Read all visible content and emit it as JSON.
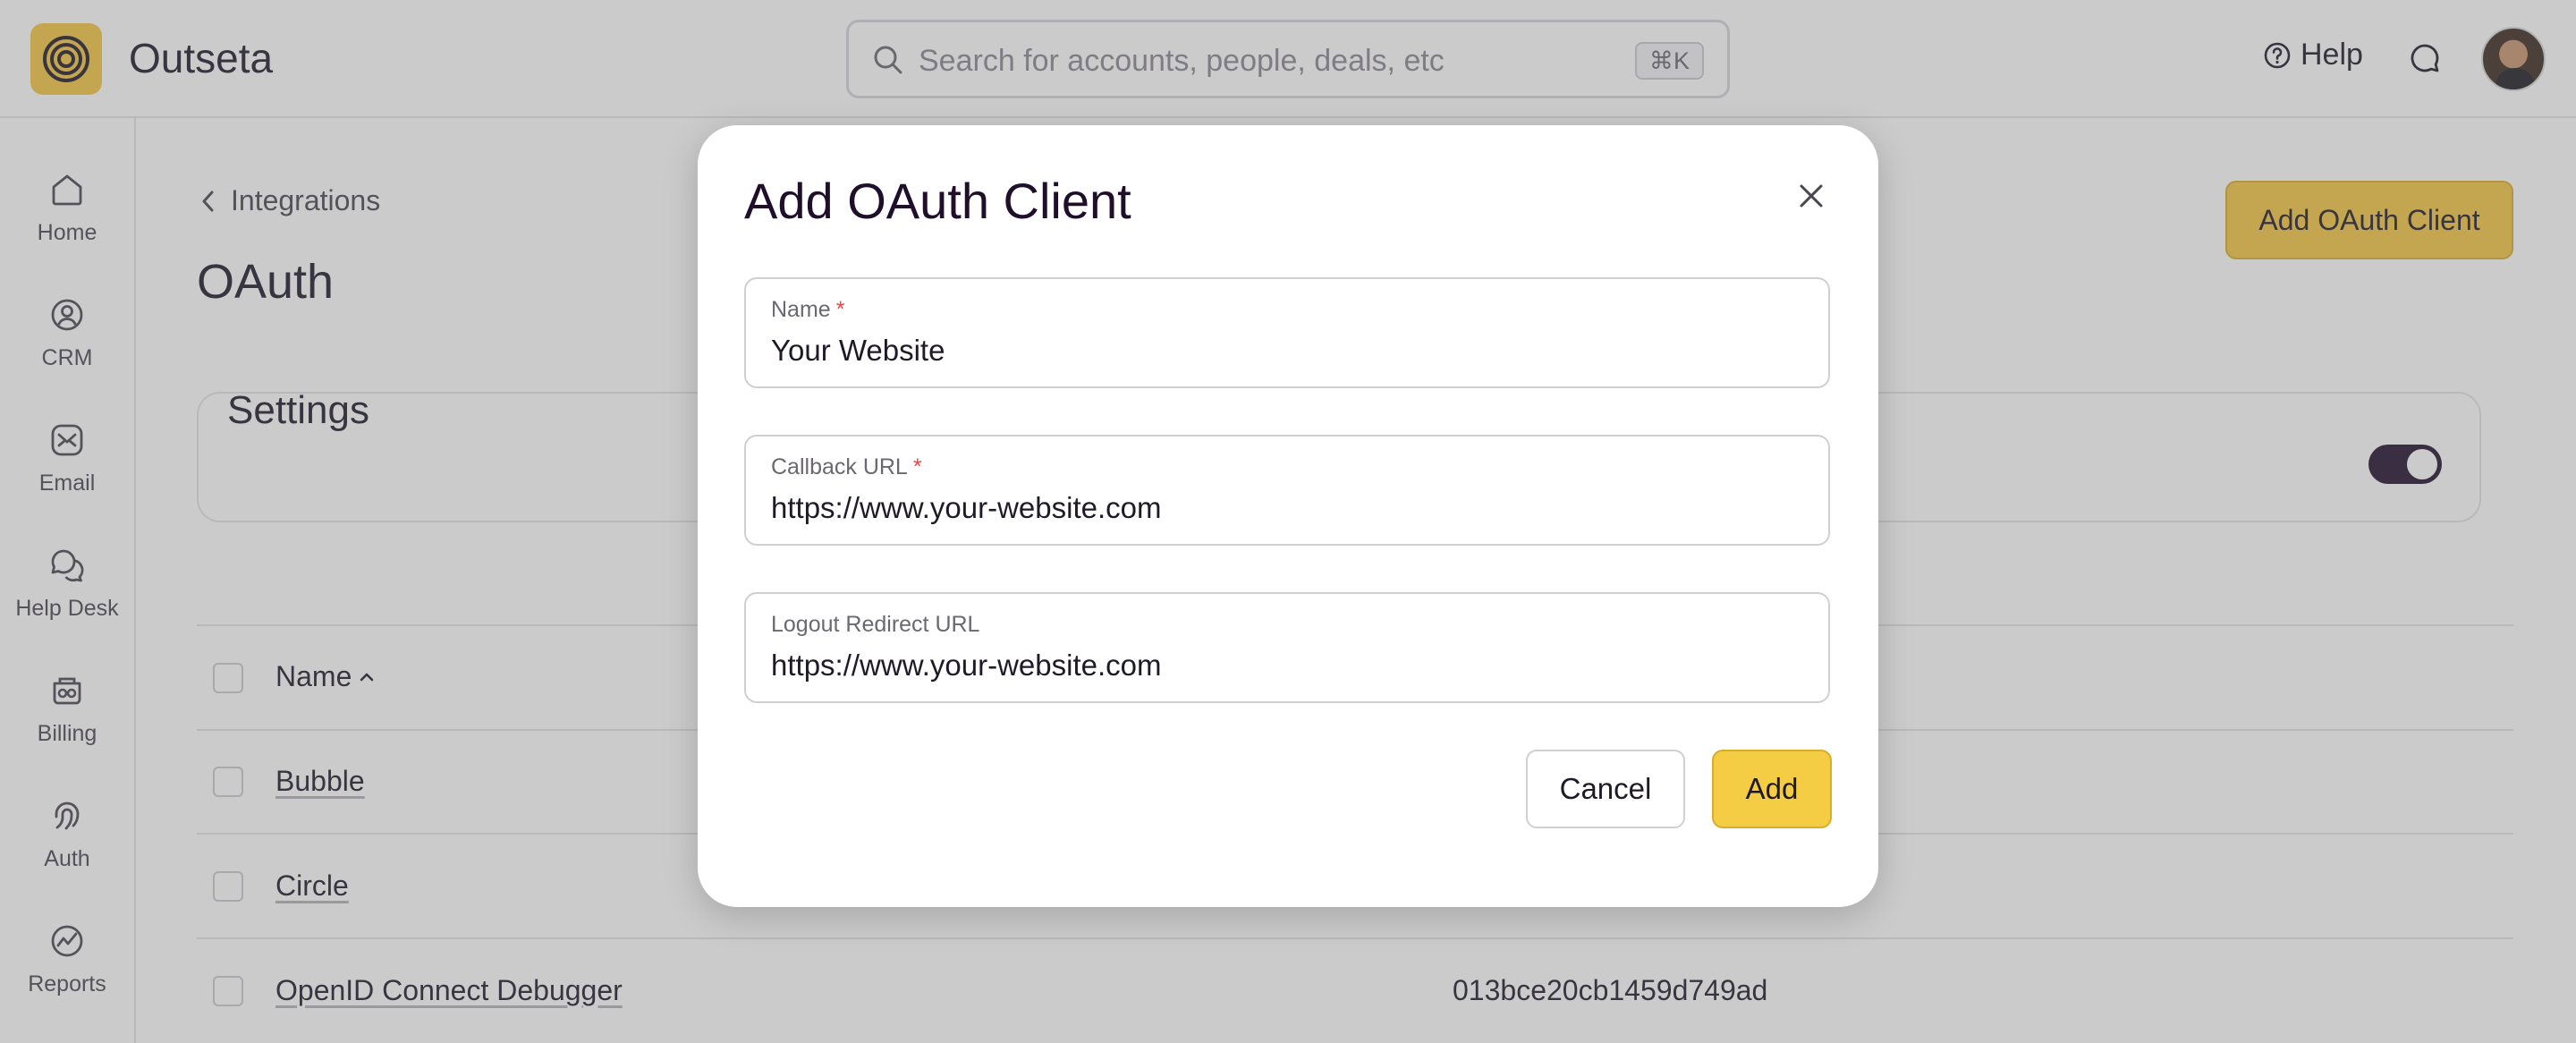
{
  "app": {
    "name": "Outseta"
  },
  "search": {
    "placeholder": "Search for accounts, people, deals, etc",
    "shortcut": "⌘K"
  },
  "header": {
    "help_label": "Help"
  },
  "sidebar": {
    "items": [
      {
        "label": "Home",
        "icon": "home-icon"
      },
      {
        "label": "CRM",
        "icon": "crm-icon"
      },
      {
        "label": "Email",
        "icon": "email-icon"
      },
      {
        "label": "Help Desk",
        "icon": "help-desk-icon"
      },
      {
        "label": "Billing",
        "icon": "billing-icon"
      },
      {
        "label": "Auth",
        "icon": "auth-icon"
      },
      {
        "label": "Reports",
        "icon": "reports-icon"
      }
    ]
  },
  "main": {
    "breadcrumb": "Integrations",
    "title": "OAuth",
    "add_button": "Add OAuth Client",
    "settings_title": "Settings",
    "table": {
      "column_name": "Name",
      "rows": [
        {
          "name": "Bubble",
          "id": ""
        },
        {
          "name": "Circle",
          "id": ""
        },
        {
          "name": "OpenID Connect Debugger",
          "id": "013bce20cb1459d749ad"
        }
      ]
    }
  },
  "modal": {
    "title": "Add OAuth Client",
    "fields": {
      "name": {
        "label": "Name",
        "required": "*",
        "value": "Your Website"
      },
      "callback_url": {
        "label": "Callback URL",
        "required": "*",
        "value": "https://www.your-website.com"
      },
      "logout_redirect_url": {
        "label": "Logout Redirect URL",
        "value": "https://www.your-website.com"
      }
    },
    "cancel_label": "Cancel",
    "add_label": "Add"
  },
  "colors": {
    "accent": "#f3c63f",
    "dark": "#1f0f2b",
    "required": "#e5484d"
  }
}
